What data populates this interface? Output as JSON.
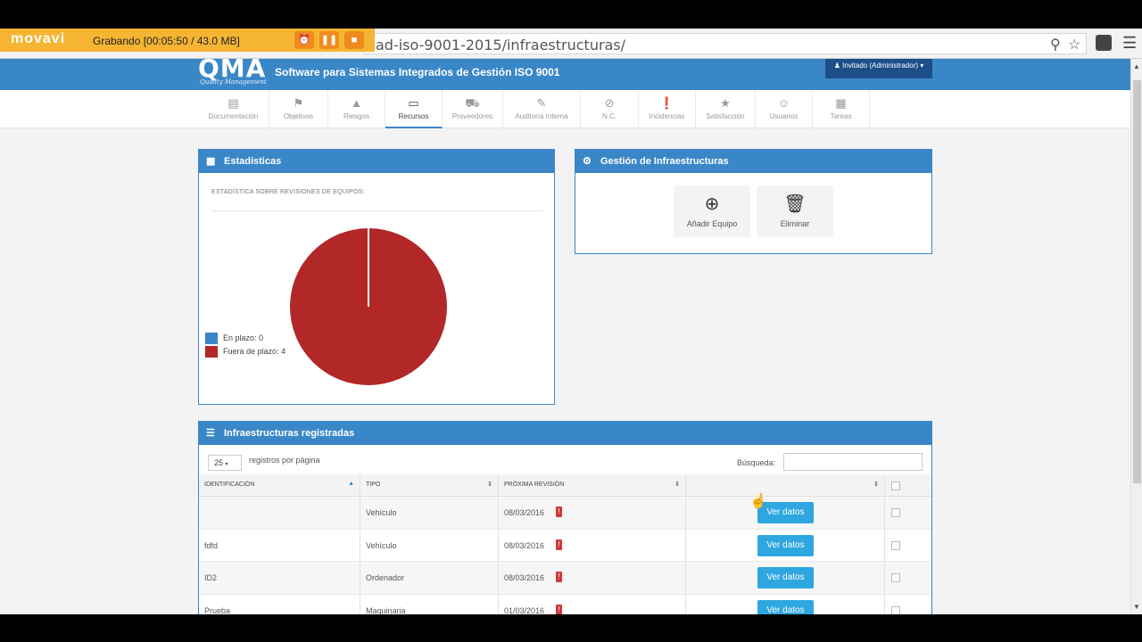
{
  "recorder": {
    "logo": "movavi",
    "status": "Grabando   [00:05:50 / 43.0 MB]",
    "buttons": [
      "alarm-clock-icon",
      "pause-icon",
      "stop-icon"
    ]
  },
  "browser": {
    "url": "ad-iso-9001-2015/infraestructuras/"
  },
  "header": {
    "logo": "QMA",
    "logo_sub": "Quality Management",
    "title": "Software para Sistemas Integrados de Gestión ISO 9001",
    "user": "Invitado (Administrador)"
  },
  "nav": {
    "items": [
      {
        "label": "Documentación",
        "icon": "document-icon"
      },
      {
        "label": "Objetivos",
        "icon": "flag-icon"
      },
      {
        "label": "Riesgos",
        "icon": "warning-icon"
      },
      {
        "label": "Recursos",
        "icon": "laptop-icon",
        "active": true
      },
      {
        "label": "Proveedores",
        "icon": "truck-icon"
      },
      {
        "label": "Auditoría Interna",
        "icon": "edit-icon"
      },
      {
        "label": "N.C.",
        "icon": "ban-icon"
      },
      {
        "label": "Incidencias",
        "icon": "alert-circle-icon"
      },
      {
        "label": "Satisfacción",
        "icon": "star-icon"
      },
      {
        "label": "Usuarios",
        "icon": "users-icon"
      },
      {
        "label": "Tareas",
        "icon": "calendar-icon"
      }
    ]
  },
  "stats": {
    "title": "Estadísticas",
    "subtitle": "ESTADÍSTICA SOBRE REVISIONES DE EQUIPOS:",
    "legend": [
      {
        "label": "En plazo: 0",
        "color": "#3a87c8"
      },
      {
        "label": "Fuera de plazo: 4",
        "color": "#b22727"
      }
    ]
  },
  "chart_data": {
    "type": "pie",
    "title": "",
    "categories": [
      "En plazo",
      "Fuera de plazo"
    ],
    "values": [
      0,
      4
    ],
    "colors": [
      "#3a87c8",
      "#b22727"
    ]
  },
  "gestion": {
    "title": "Gestión de Infraestructuras",
    "add_label": "Añadir Equipo",
    "delete_label": "Eliminar"
  },
  "registros": {
    "title": "Infraestructuras registradas",
    "per_page": "25",
    "per_page_label": "registros por página",
    "search_label": "Búsqueda:",
    "search_value": "",
    "columns": [
      "IDENTIFICACIÓN",
      "TIPO",
      "PRÓXIMA REVISIÓN",
      ""
    ],
    "rows": [
      {
        "id": "",
        "tipo": "Vehículo",
        "fecha": "08/03/2016",
        "action": "Ver datos"
      },
      {
        "id": "fdfd",
        "tipo": "Vehículo",
        "fecha": "08/03/2016",
        "action": "Ver datos"
      },
      {
        "id": "ID2",
        "tipo": "Ordenador",
        "fecha": "08/03/2016",
        "action": "Ver datos"
      },
      {
        "id": "Prueba",
        "tipo": "Maquinaria",
        "fecha": "01/03/2016",
        "action": "Ver datos"
      }
    ]
  }
}
